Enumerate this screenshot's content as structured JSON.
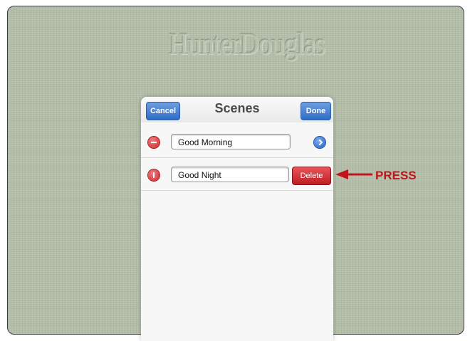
{
  "brand": {
    "logo_text": "HunterDouglas"
  },
  "panel": {
    "title": "Scenes",
    "cancel_label": "Cancel",
    "done_label": "Done"
  },
  "scenes": [
    {
      "name": "Good Morning",
      "delete_control": "minus-circle",
      "accessory": "disclosure-icon"
    },
    {
      "name": "Good Night",
      "delete_control": "minus-circle-rotated",
      "delete_label": "Delete"
    }
  ],
  "annotation": {
    "label": "PRESS",
    "color": "#c0151b"
  },
  "colors": {
    "background": "#b3bda8",
    "nav_button": "#2f6cc7",
    "delete_button": "#c11d25"
  }
}
